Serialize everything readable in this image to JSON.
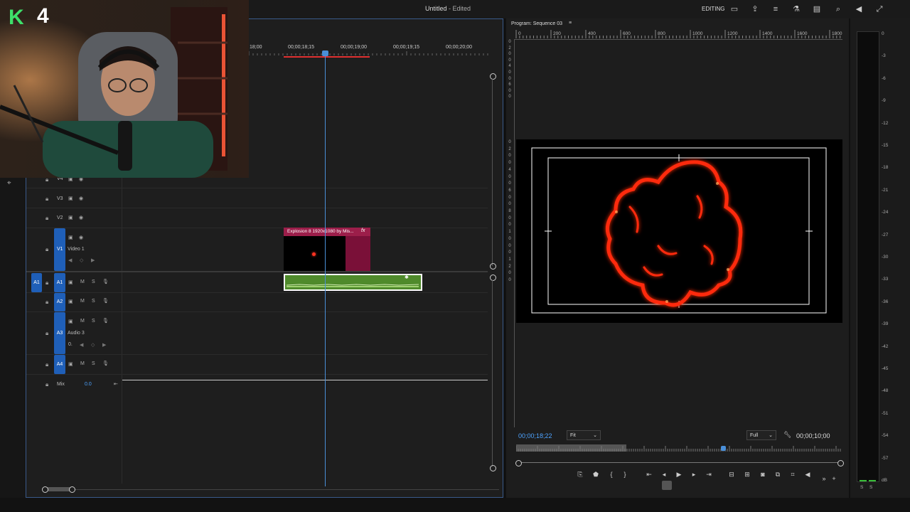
{
  "app": {
    "title": "Untitled",
    "title_status": "- Edited",
    "workspace": "EDITING"
  },
  "overlay": {
    "logo_letter": "K",
    "logo_number": "4"
  },
  "timeline": {
    "ruler_labels": [
      "18;00",
      "00;00;18;15",
      "00;00;19;00",
      "00;00;19;15",
      "00;00;20;00"
    ],
    "video_tracks": [
      {
        "id": "V4",
        "label": "V4",
        "name": ""
      },
      {
        "id": "V3",
        "label": "V3",
        "name": ""
      },
      {
        "id": "V2",
        "label": "V2",
        "name": ""
      },
      {
        "id": "V1",
        "label": "V1",
        "name": "Video 1"
      }
    ],
    "audio_tracks": [
      {
        "id": "A1",
        "label": "A1",
        "source_label": "A1",
        "name": ""
      },
      {
        "id": "A2",
        "label": "A2",
        "name": ""
      },
      {
        "id": "A3",
        "label": "A3",
        "name": "Audio 3",
        "value": "0."
      },
      {
        "id": "A4",
        "label": "A4",
        "name": ""
      }
    ],
    "mute_label": "M",
    "solo_label": "S",
    "mix_label": "Mix",
    "mix_value": "0.0",
    "video_clip_name": "Explosion 8 1920x1080 by Mis...",
    "video_clip_fx": "fx"
  },
  "program": {
    "title": "Program: Sequence 03",
    "ruler_labels": [
      "0",
      "200",
      "400",
      "600",
      "800",
      "1000",
      "1200",
      "1400",
      "1600",
      "1800"
    ],
    "vruler_top": [
      "0",
      "2",
      "0",
      "0",
      "4",
      "0",
      "0",
      "6",
      "0",
      "0"
    ],
    "vruler_bottom": [
      "0",
      "2",
      "0",
      "0",
      "4",
      "0",
      "0",
      "6",
      "0",
      "0",
      "8",
      "0",
      "0",
      "1",
      "0",
      "0",
      "0",
      "1",
      "2",
      "0",
      "0"
    ],
    "current_timecode": "00;00;18;22",
    "zoom": "Fit",
    "resolution": "Full",
    "duration_timecode": "00;00;10;00",
    "playhead_fraction": 0.64
  },
  "meters": {
    "scale": [
      "0",
      "-3",
      "-6",
      "-9",
      "-12",
      "-15",
      "-18",
      "-21",
      "-24",
      "-27",
      "-30",
      "-33",
      "-36",
      "-39",
      "-42",
      "-45",
      "-48",
      "-51",
      "-54",
      "-57",
      "dB"
    ],
    "solo_labels": [
      "S",
      "S"
    ]
  },
  "colors": {
    "accent": "#1f5fb8",
    "timecode_blue": "#4da3ff",
    "video_clip": "#9c1e4a",
    "audio_clip": "#4f8a2b",
    "explosion": "#ff2a10"
  }
}
